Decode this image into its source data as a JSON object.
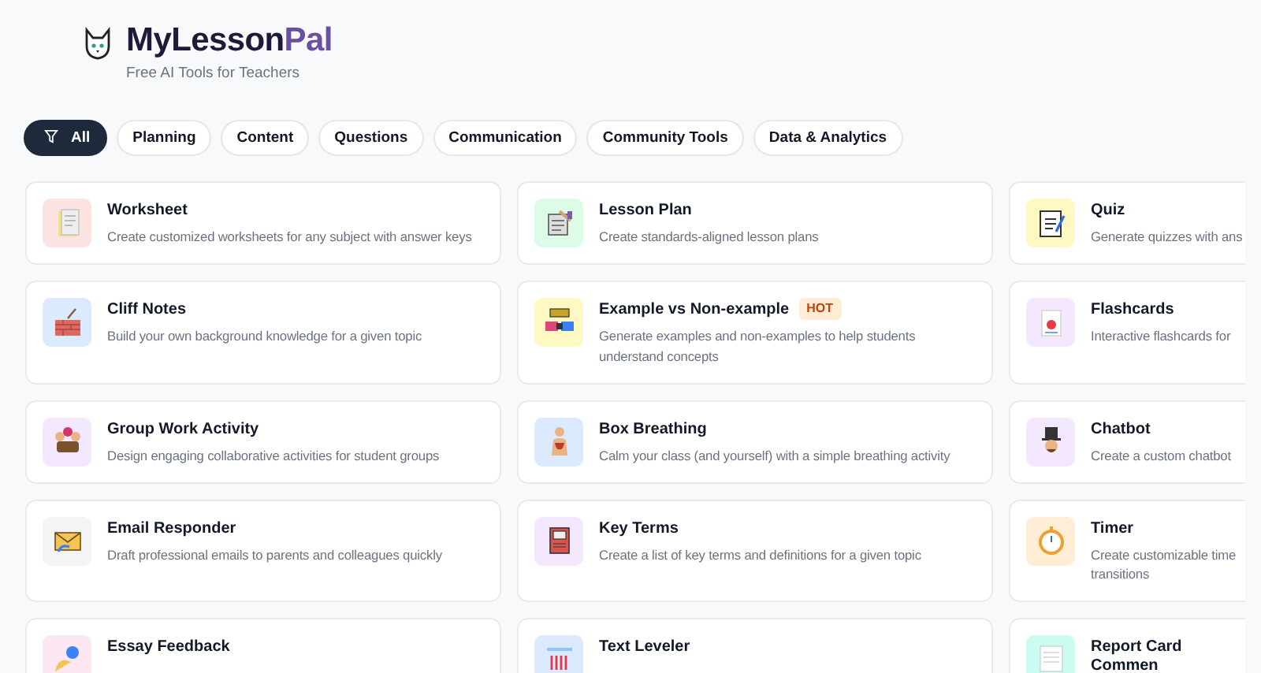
{
  "brand": {
    "name": "MyLesson",
    "accent": "Pal",
    "tagline": "Free AI Tools for Teachers"
  },
  "filters": [
    {
      "label": "All",
      "selected": true
    },
    {
      "label": "Planning",
      "selected": false
    },
    {
      "label": "Content",
      "selected": false
    },
    {
      "label": "Questions",
      "selected": false
    },
    {
      "label": "Communication",
      "selected": false
    },
    {
      "label": "Community Tools",
      "selected": false
    },
    {
      "label": "Data & Analytics",
      "selected": false
    }
  ],
  "tools": [
    {
      "title": "Worksheet",
      "description": "Create customized worksheets for any subject with answer keys",
      "color": "#fde2e2"
    },
    {
      "title": "Lesson Plan",
      "description": "Create standards-aligned lesson plans",
      "color": "#dcfce7"
    },
    {
      "title": "Quiz",
      "description": "Generate quizzes with ans",
      "color": "#fef9c3"
    },
    {
      "title": "Cliff Notes",
      "description": "Build your own background knowledge for a given topic",
      "color": "#dbeafe"
    },
    {
      "title": "Example vs Non-example",
      "badge": "HOT",
      "description": "Generate examples and non-examples to help students understand concepts",
      "color": "#fef9c3"
    },
    {
      "title": "Flashcards",
      "description": "Interactive flashcards for",
      "color": "#f3e8ff"
    },
    {
      "title": "Group Work Activity",
      "description": "Design engaging collaborative activities for student groups",
      "color": "#f3e8ff"
    },
    {
      "title": "Box Breathing",
      "description": "Calm your class (and yourself) with a simple breathing activity",
      "color": "#dbeafe"
    },
    {
      "title": "Chatbot",
      "description": "Create a custom chatbot",
      "color": "#f3e8ff"
    },
    {
      "title": "Email Responder",
      "description": "Draft professional emails to parents and colleagues quickly",
      "color": "#f3f4f6"
    },
    {
      "title": "Key Terms",
      "description": "Create a list of key terms and definitions for a given topic",
      "color": "#f3e8ff"
    },
    {
      "title": "Timer",
      "description": "Create customizable time\ntransitions",
      "color": "#ffedd5"
    },
    {
      "title": "Essay Feedback",
      "color": "#fce7f3"
    },
    {
      "title": "Text Leveler",
      "color": "#dbeafe"
    },
    {
      "title": "Report Card Commen",
      "color": "#ccfbf1"
    }
  ]
}
